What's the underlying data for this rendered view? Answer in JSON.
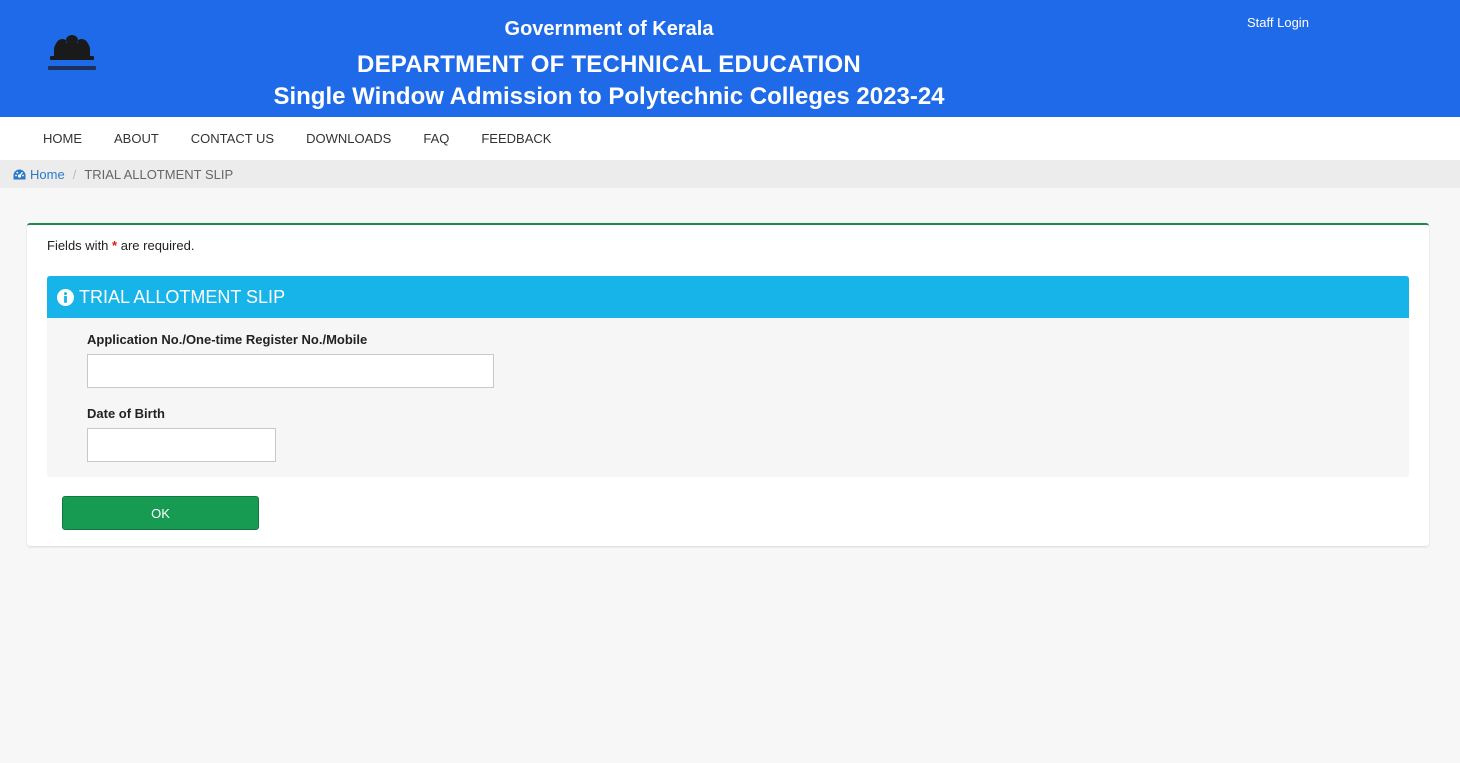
{
  "header": {
    "gov_title": "Government of Kerala",
    "dept_title": "DEPARTMENT OF TECHNICAL EDUCATION",
    "swa_title": "Single Window Admission to Polytechnic Colleges 2023-24",
    "staff_login": "Staff Login",
    "emblem_icon": "kerala-emblem-icon"
  },
  "nav": {
    "items": [
      {
        "label": "HOME"
      },
      {
        "label": "ABOUT"
      },
      {
        "label": "CONTACT US"
      },
      {
        "label": "DOWNLOADS"
      },
      {
        "label": "FAQ"
      },
      {
        "label": "FEEDBACK"
      }
    ]
  },
  "breadcrumb": {
    "home_label": "Home",
    "home_icon": "dashboard-icon",
    "current": "TRIAL ALLOTMENT SLIP"
  },
  "form": {
    "required_prefix": "Fields with",
    "required_star": "*",
    "required_suffix": "are required.",
    "panel_title": "TRIAL ALLOTMENT SLIP",
    "panel_icon": "info-circle-icon",
    "fields": [
      {
        "label": "Application No./One-time Register No./Mobile",
        "value": "",
        "placeholder": ""
      },
      {
        "label": "Date of Birth",
        "value": "",
        "placeholder": ""
      }
    ],
    "ok_label": "OK"
  },
  "colors": {
    "header_bg": "#1f6ae8",
    "panel_head_bg": "#16b4e8",
    "ok_button_bg": "#179b53",
    "card_top_border": "#1c8a4a",
    "required_star": "#d9181f"
  }
}
